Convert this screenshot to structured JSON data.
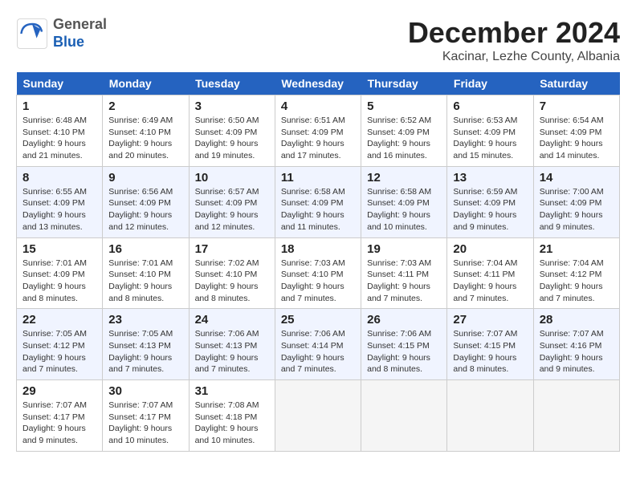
{
  "header": {
    "logo_general": "General",
    "logo_blue": "Blue",
    "month": "December 2024",
    "location": "Kacinar, Lezhe County, Albania"
  },
  "days_of_week": [
    "Sunday",
    "Monday",
    "Tuesday",
    "Wednesday",
    "Thursday",
    "Friday",
    "Saturday"
  ],
  "weeks": [
    [
      {
        "day": "1",
        "info": "Sunrise: 6:48 AM\nSunset: 4:10 PM\nDaylight: 9 hours\nand 21 minutes."
      },
      {
        "day": "2",
        "info": "Sunrise: 6:49 AM\nSunset: 4:10 PM\nDaylight: 9 hours\nand 20 minutes."
      },
      {
        "day": "3",
        "info": "Sunrise: 6:50 AM\nSunset: 4:09 PM\nDaylight: 9 hours\nand 19 minutes."
      },
      {
        "day": "4",
        "info": "Sunrise: 6:51 AM\nSunset: 4:09 PM\nDaylight: 9 hours\nand 17 minutes."
      },
      {
        "day": "5",
        "info": "Sunrise: 6:52 AM\nSunset: 4:09 PM\nDaylight: 9 hours\nand 16 minutes."
      },
      {
        "day": "6",
        "info": "Sunrise: 6:53 AM\nSunset: 4:09 PM\nDaylight: 9 hours\nand 15 minutes."
      },
      {
        "day": "7",
        "info": "Sunrise: 6:54 AM\nSunset: 4:09 PM\nDaylight: 9 hours\nand 14 minutes."
      }
    ],
    [
      {
        "day": "8",
        "info": "Sunrise: 6:55 AM\nSunset: 4:09 PM\nDaylight: 9 hours\nand 13 minutes."
      },
      {
        "day": "9",
        "info": "Sunrise: 6:56 AM\nSunset: 4:09 PM\nDaylight: 9 hours\nand 12 minutes."
      },
      {
        "day": "10",
        "info": "Sunrise: 6:57 AM\nSunset: 4:09 PM\nDaylight: 9 hours\nand 12 minutes."
      },
      {
        "day": "11",
        "info": "Sunrise: 6:58 AM\nSunset: 4:09 PM\nDaylight: 9 hours\nand 11 minutes."
      },
      {
        "day": "12",
        "info": "Sunrise: 6:58 AM\nSunset: 4:09 PM\nDaylight: 9 hours\nand 10 minutes."
      },
      {
        "day": "13",
        "info": "Sunrise: 6:59 AM\nSunset: 4:09 PM\nDaylight: 9 hours\nand 9 minutes."
      },
      {
        "day": "14",
        "info": "Sunrise: 7:00 AM\nSunset: 4:09 PM\nDaylight: 9 hours\nand 9 minutes."
      }
    ],
    [
      {
        "day": "15",
        "info": "Sunrise: 7:01 AM\nSunset: 4:09 PM\nDaylight: 9 hours\nand 8 minutes."
      },
      {
        "day": "16",
        "info": "Sunrise: 7:01 AM\nSunset: 4:10 PM\nDaylight: 9 hours\nand 8 minutes."
      },
      {
        "day": "17",
        "info": "Sunrise: 7:02 AM\nSunset: 4:10 PM\nDaylight: 9 hours\nand 8 minutes."
      },
      {
        "day": "18",
        "info": "Sunrise: 7:03 AM\nSunset: 4:10 PM\nDaylight: 9 hours\nand 7 minutes."
      },
      {
        "day": "19",
        "info": "Sunrise: 7:03 AM\nSunset: 4:11 PM\nDaylight: 9 hours\nand 7 minutes."
      },
      {
        "day": "20",
        "info": "Sunrise: 7:04 AM\nSunset: 4:11 PM\nDaylight: 9 hours\nand 7 minutes."
      },
      {
        "day": "21",
        "info": "Sunrise: 7:04 AM\nSunset: 4:12 PM\nDaylight: 9 hours\nand 7 minutes."
      }
    ],
    [
      {
        "day": "22",
        "info": "Sunrise: 7:05 AM\nSunset: 4:12 PM\nDaylight: 9 hours\nand 7 minutes."
      },
      {
        "day": "23",
        "info": "Sunrise: 7:05 AM\nSunset: 4:13 PM\nDaylight: 9 hours\nand 7 minutes."
      },
      {
        "day": "24",
        "info": "Sunrise: 7:06 AM\nSunset: 4:13 PM\nDaylight: 9 hours\nand 7 minutes."
      },
      {
        "day": "25",
        "info": "Sunrise: 7:06 AM\nSunset: 4:14 PM\nDaylight: 9 hours\nand 7 minutes."
      },
      {
        "day": "26",
        "info": "Sunrise: 7:06 AM\nSunset: 4:15 PM\nDaylight: 9 hours\nand 8 minutes."
      },
      {
        "day": "27",
        "info": "Sunrise: 7:07 AM\nSunset: 4:15 PM\nDaylight: 9 hours\nand 8 minutes."
      },
      {
        "day": "28",
        "info": "Sunrise: 7:07 AM\nSunset: 4:16 PM\nDaylight: 9 hours\nand 9 minutes."
      }
    ],
    [
      {
        "day": "29",
        "info": "Sunrise: 7:07 AM\nSunset: 4:17 PM\nDaylight: 9 hours\nand 9 minutes."
      },
      {
        "day": "30",
        "info": "Sunrise: 7:07 AM\nSunset: 4:17 PM\nDaylight: 9 hours\nand 10 minutes."
      },
      {
        "day": "31",
        "info": "Sunrise: 7:08 AM\nSunset: 4:18 PM\nDaylight: 9 hours\nand 10 minutes."
      },
      {
        "day": "",
        "info": ""
      },
      {
        "day": "",
        "info": ""
      },
      {
        "day": "",
        "info": ""
      },
      {
        "day": "",
        "info": ""
      }
    ]
  ]
}
